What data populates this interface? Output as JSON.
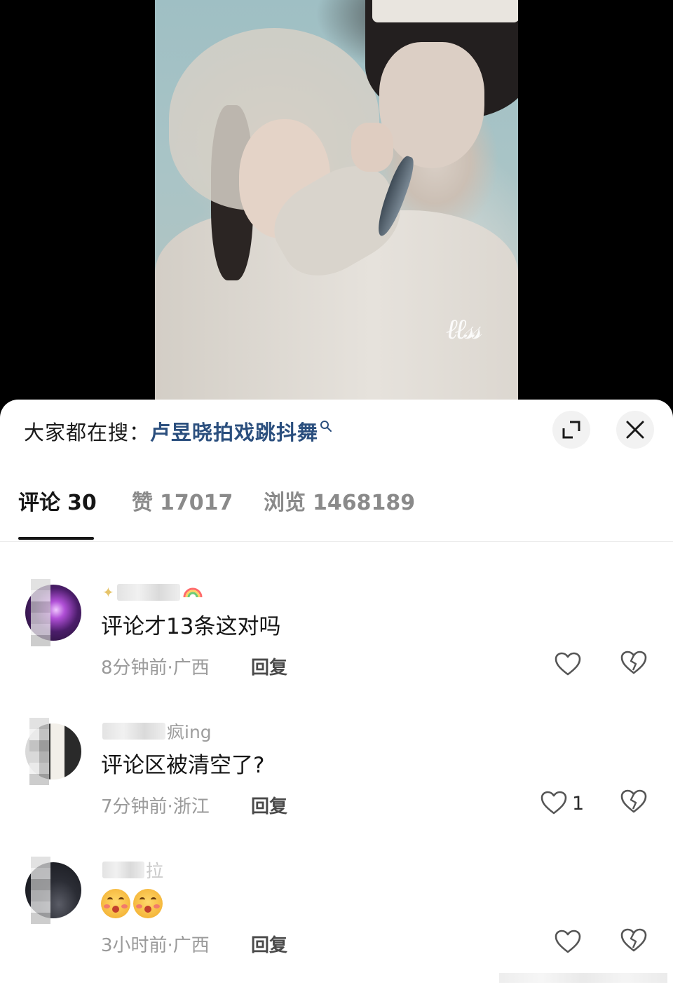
{
  "search_bar": {
    "label": "大家都在搜：",
    "term": "卢昱晓拍戏跳抖舞"
  },
  "tabs": [
    {
      "label": "评论",
      "count": "30"
    },
    {
      "label": "赞",
      "count": "17017"
    },
    {
      "label": "浏览",
      "count": "1468189"
    }
  ],
  "comments": [
    {
      "username_visible": "",
      "text": "评论才13条这对吗",
      "meta": "8分钟前·广西",
      "reply_label": "回复",
      "likes": "",
      "username_emoji": "✨ 🌈"
    },
    {
      "username_visible": "疯ing",
      "text": "评论区被清空了?",
      "meta": "7分钟前·浙江",
      "reply_label": "回复",
      "likes": "1"
    },
    {
      "username_visible": "拉",
      "text": "",
      "meta": "3小时前·广西",
      "reply_label": "回复",
      "likes": "",
      "emoji_count": 2
    }
  ],
  "icons": {
    "expand": "expand-icon",
    "close": "close-icon",
    "like": "heart-icon",
    "dislike": "broken-heart-icon",
    "search": "search-icon"
  },
  "colors": {
    "search_term": "#2b4f7e",
    "tab_active": "#161616",
    "tab_inactive": "#8a8a8a",
    "meta": "#9a9a9a"
  }
}
